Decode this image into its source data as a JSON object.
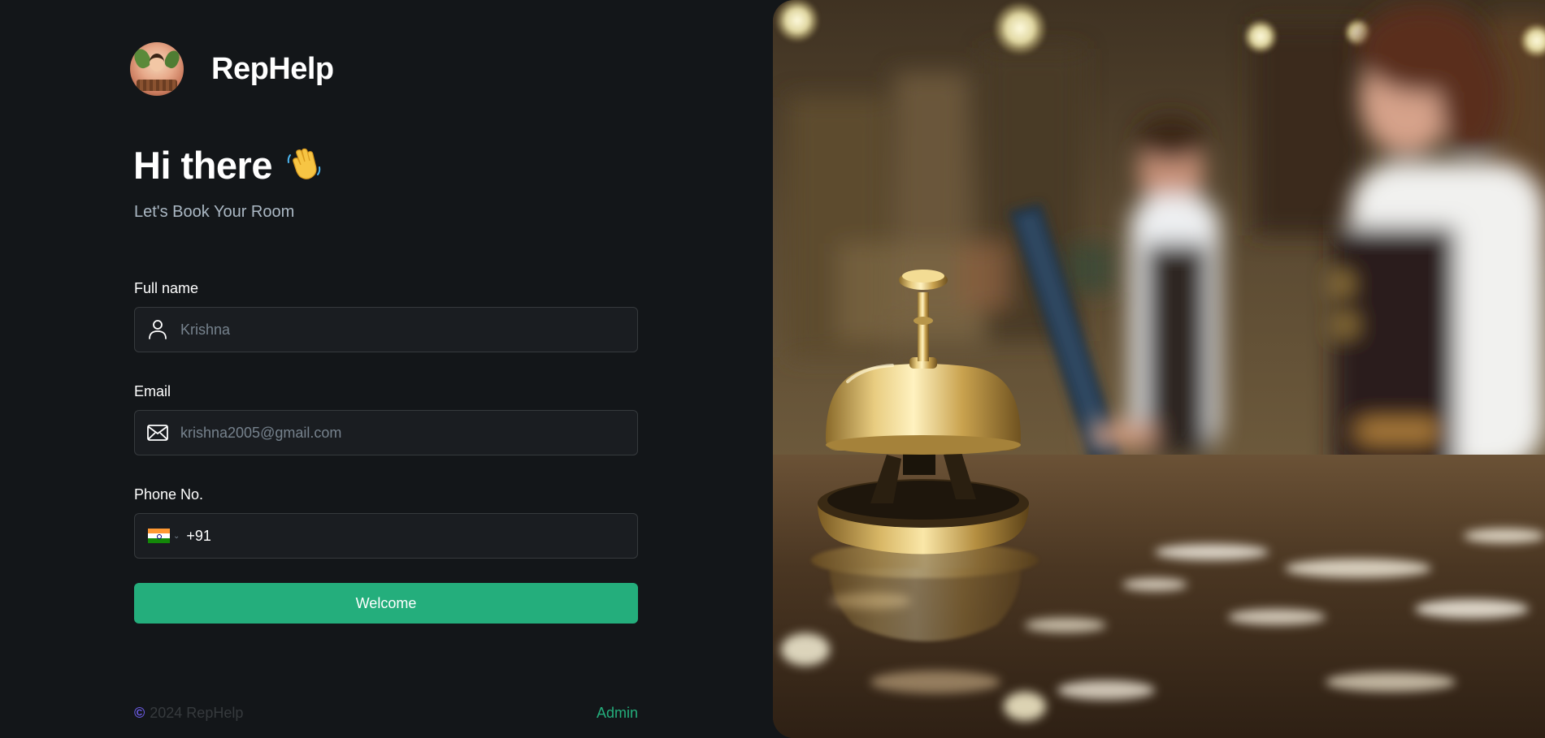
{
  "brand": {
    "name": "RepHelp",
    "logo_icon": "receptionist-avatar-icon"
  },
  "greeting": {
    "title": "Hi there",
    "emoji": "waving-hand-icon",
    "subtitle": "Let's Book Your Room"
  },
  "form": {
    "full_name": {
      "label": "Full name",
      "placeholder": "Krishna",
      "value": "",
      "icon": "user-icon"
    },
    "email": {
      "label": "Email",
      "placeholder": "krishna2005@gmail.com",
      "value": "",
      "icon": "envelope-icon"
    },
    "phone": {
      "label": "Phone No.",
      "country_flag": "india-flag-icon",
      "dial_code": "+91",
      "value": ""
    },
    "submit_label": "Welcome"
  },
  "footer": {
    "copyright": "2024 RepHelp",
    "admin_label": "Admin"
  },
  "hero_image": {
    "subject": "hotel-reception-bell-photo"
  },
  "colors": {
    "background": "#131619",
    "input_bg": "#1a1d21",
    "input_border": "#363a3d",
    "accent_green": "#24ae7c",
    "subtitle": "#abb8c4",
    "copyright_icon": "#6c5ce7"
  }
}
